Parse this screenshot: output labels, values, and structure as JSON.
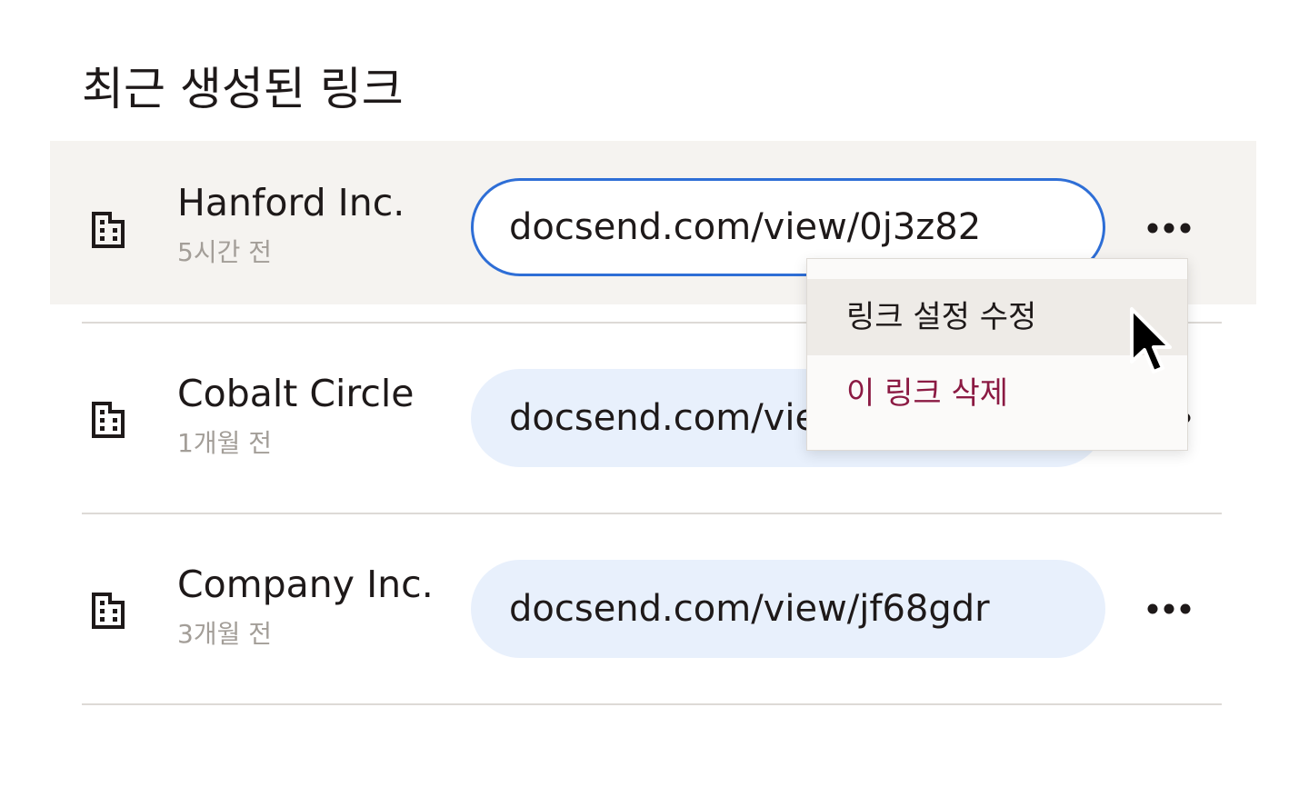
{
  "page": {
    "title": "최근 생성된 링크"
  },
  "links": [
    {
      "company": "Hanford Inc.",
      "time": "5시간 전",
      "url": "docsend.com/view/0j3z82",
      "state": "active"
    },
    {
      "company": "Cobalt Circle",
      "time": "1개월 전",
      "url": "docsend.com/view/...",
      "state": "default"
    },
    {
      "company": "Company Inc.",
      "time": "3개월 전",
      "url": "docsend.com/view/jf68gdr",
      "state": "default"
    }
  ],
  "dropdown": {
    "items": [
      {
        "label": "링크 설정 수정",
        "state": "hover"
      },
      {
        "label": "이 링크 삭제",
        "state": "danger"
      }
    ]
  },
  "colors": {
    "accent_border": "#2e6ed6",
    "pill_background": "#e8f0fc",
    "row_highlight": "#f5f3f0",
    "danger_text": "#8b1a43",
    "muted_text": "#a39e98"
  },
  "icons": {
    "company": "building-icon",
    "more": "more-horizontal-icon",
    "cursor": "mouse-pointer-icon"
  }
}
